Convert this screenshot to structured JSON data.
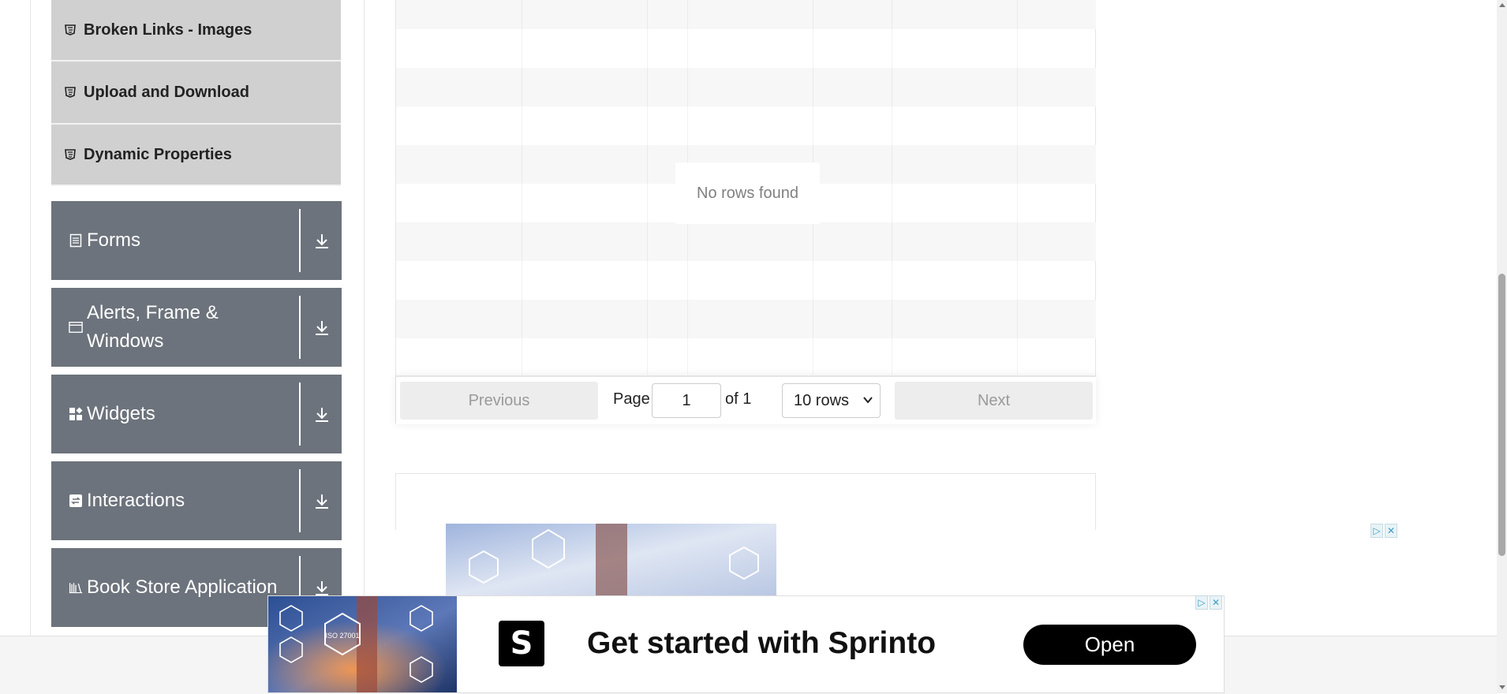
{
  "sidebar": {
    "elements_items": [
      {
        "label": "Broken Links - Images",
        "icon": "html5-icon"
      },
      {
        "label": "Upload and Download",
        "icon": "html5-icon"
      },
      {
        "label": "Dynamic Properties",
        "icon": "html5-icon"
      }
    ],
    "groups": [
      {
        "label": "Forms",
        "icon": "form-icon"
      },
      {
        "label": "Alerts, Frame & Windows",
        "icon": "window-icon"
      },
      {
        "label": "Widgets",
        "icon": "widgets-icon"
      },
      {
        "label": "Interactions",
        "icon": "interactions-icon"
      },
      {
        "label": "Book Store Application",
        "icon": "books-icon"
      }
    ]
  },
  "table": {
    "empty_text": "No rows found",
    "pagination": {
      "previous_label": "Previous",
      "page_label": "Page",
      "page_value": "1",
      "of_label": "of 1",
      "rows_select": "10 rows",
      "next_label": "Next"
    }
  },
  "ad_banner": {
    "headline": "Get started with Sprinto",
    "cta": "Open",
    "logo_letter": "S",
    "image_caption": "ISO 27001"
  },
  "colors": {
    "sidebar_group_bg": "#6c737c",
    "sidebar_item_bg": "#d0d0d0",
    "button_disabled_bg": "#ededed"
  }
}
